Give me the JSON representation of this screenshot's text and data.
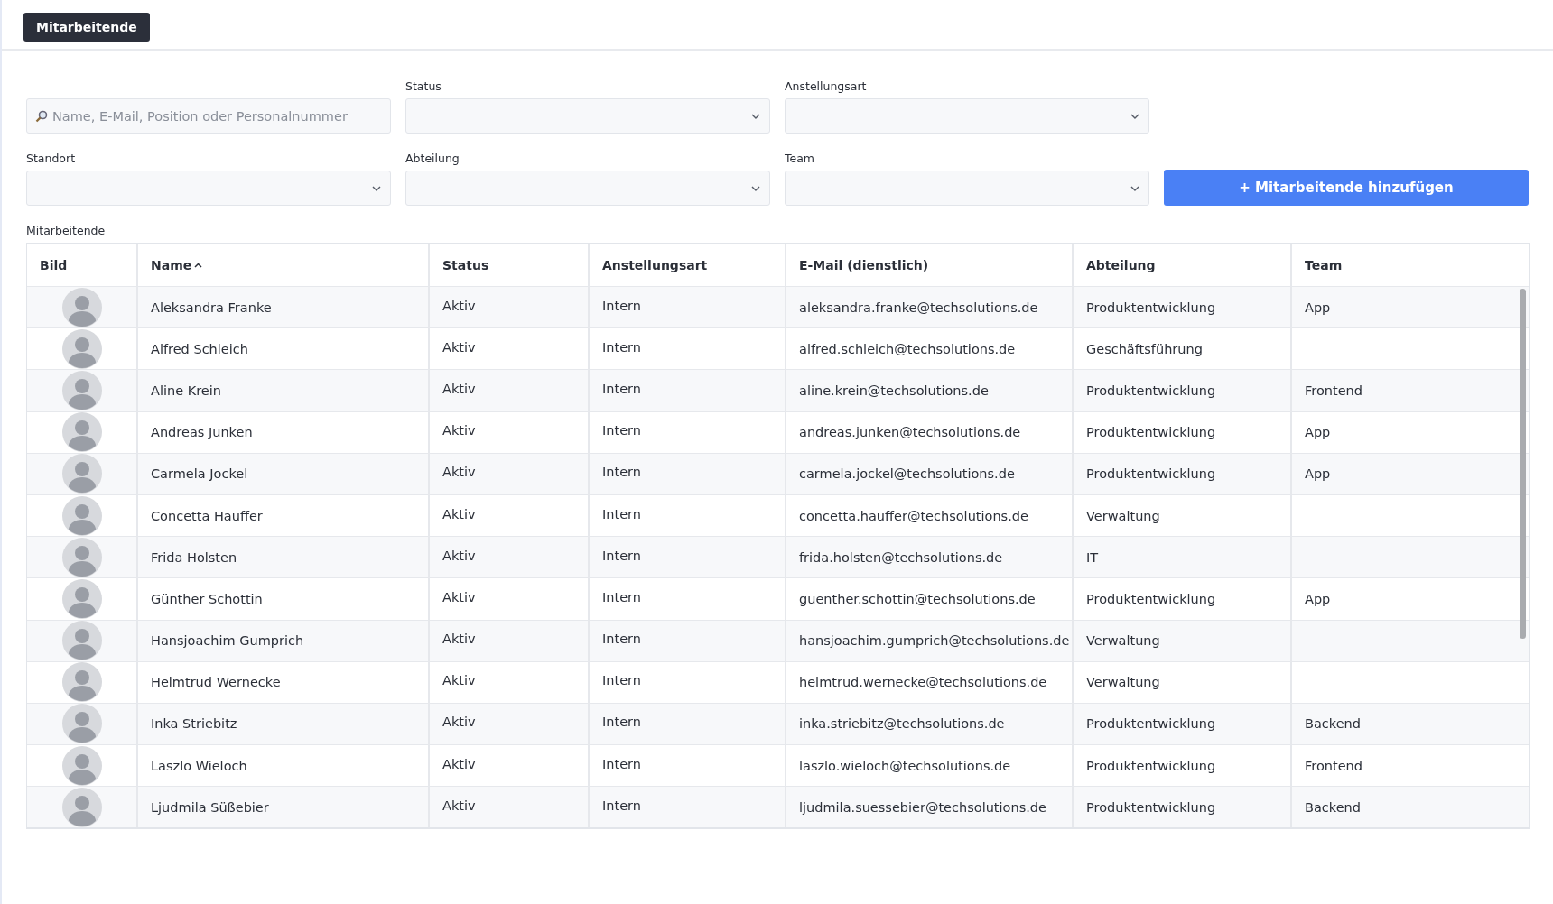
{
  "tab": {
    "label": "Mitarbeitende",
    "selected": true
  },
  "filters": {
    "search": {
      "placeholder": "Name, E-Mail, Position oder Personalnummer"
    },
    "selects": [
      {
        "label": "Status"
      },
      {
        "label": "Anstellungsart"
      },
      {
        "label": "Standort"
      },
      {
        "label": "Abteilung"
      },
      {
        "label": "Team"
      }
    ]
  },
  "add_button": "+ Mitarbeitende hinzufügen",
  "table": {
    "caption": "Mitarbeitende",
    "columns": [
      {
        "label": "Bild",
        "sorted": false
      },
      {
        "label": "Name",
        "sorted": true
      },
      {
        "label": "Status",
        "sorted": false
      },
      {
        "label": "Anstellungsart",
        "sorted": false
      },
      {
        "label": "E-Mail (dienstlich)",
        "sorted": false
      },
      {
        "label": "Abteilung",
        "sorted": false
      },
      {
        "label": "Team",
        "sorted": false
      }
    ],
    "rows": [
      {
        "name": "Aleksandra Franke",
        "status": "Aktiv",
        "type": "Intern",
        "email": "aleksandra.franke@techsolutions.de",
        "department": "Produktentwicklung",
        "team": "App"
      },
      {
        "name": "Alfred Schleich",
        "status": "Aktiv",
        "type": "Intern",
        "email": "alfred.schleich@techsolutions.de",
        "department": "Geschäftsführung"
      },
      {
        "name": "Aline Krein",
        "status": "Aktiv",
        "type": "Intern",
        "email": "aline.krein@techsolutions.de",
        "department": "Produktentwicklung",
        "team": "Frontend"
      },
      {
        "name": "Andreas Junken",
        "status": "Aktiv",
        "type": "Intern",
        "email": "andreas.junken@techsolutions.de",
        "department": "Produktentwicklung",
        "team": "App"
      },
      {
        "name": "Carmela Jockel",
        "status": "Aktiv",
        "type": "Intern",
        "email": "carmela.jockel@techsolutions.de",
        "department": "Produktentwicklung",
        "team": "App"
      },
      {
        "name": "Concetta Hauffer",
        "status": "Aktiv",
        "type": "Intern",
        "email": "concetta.hauffer@techsolutions.de",
        "department": "Verwaltung"
      },
      {
        "name": "Frida Holsten",
        "status": "Aktiv",
        "type": "Intern",
        "email": "frida.holsten@techsolutions.de",
        "department": "IT"
      },
      {
        "name": "Günther Schottin",
        "status": "Aktiv",
        "type": "Intern",
        "email": "guenther.schottin@techsolutions.de",
        "department": "Produktentwicklung",
        "team": "App"
      },
      {
        "name": "Hansjoachim Gumprich",
        "status": "Aktiv",
        "type": "Intern",
        "email": "hansjoachim.gumprich@techsolutions.de",
        "department": "Verwaltung"
      },
      {
        "name": "Helmtrud Wernecke",
        "status": "Aktiv",
        "type": "Intern",
        "email": "helmtrud.wernecke@techsolutions.de",
        "department": "Verwaltung"
      },
      {
        "name": "Inka Striebitz",
        "status": "Aktiv",
        "type": "Intern",
        "email": "inka.striebitz@techsolutions.de",
        "department": "Produktentwicklung",
        "team": "Backend"
      },
      {
        "name": "Laszlo Wieloch",
        "status": "Aktiv",
        "type": "Intern",
        "email": "laszlo.wieloch@techsolutions.de",
        "department": "Produktentwicklung",
        "team": "Frontend"
      },
      {
        "name": "Ljudmila Süßebier",
        "status": "Aktiv",
        "type": "Intern",
        "email": "ljudmila.suessebier@techsolutions.de",
        "department": "Produktentwicklung",
        "team": "Backend"
      }
    ]
  }
}
